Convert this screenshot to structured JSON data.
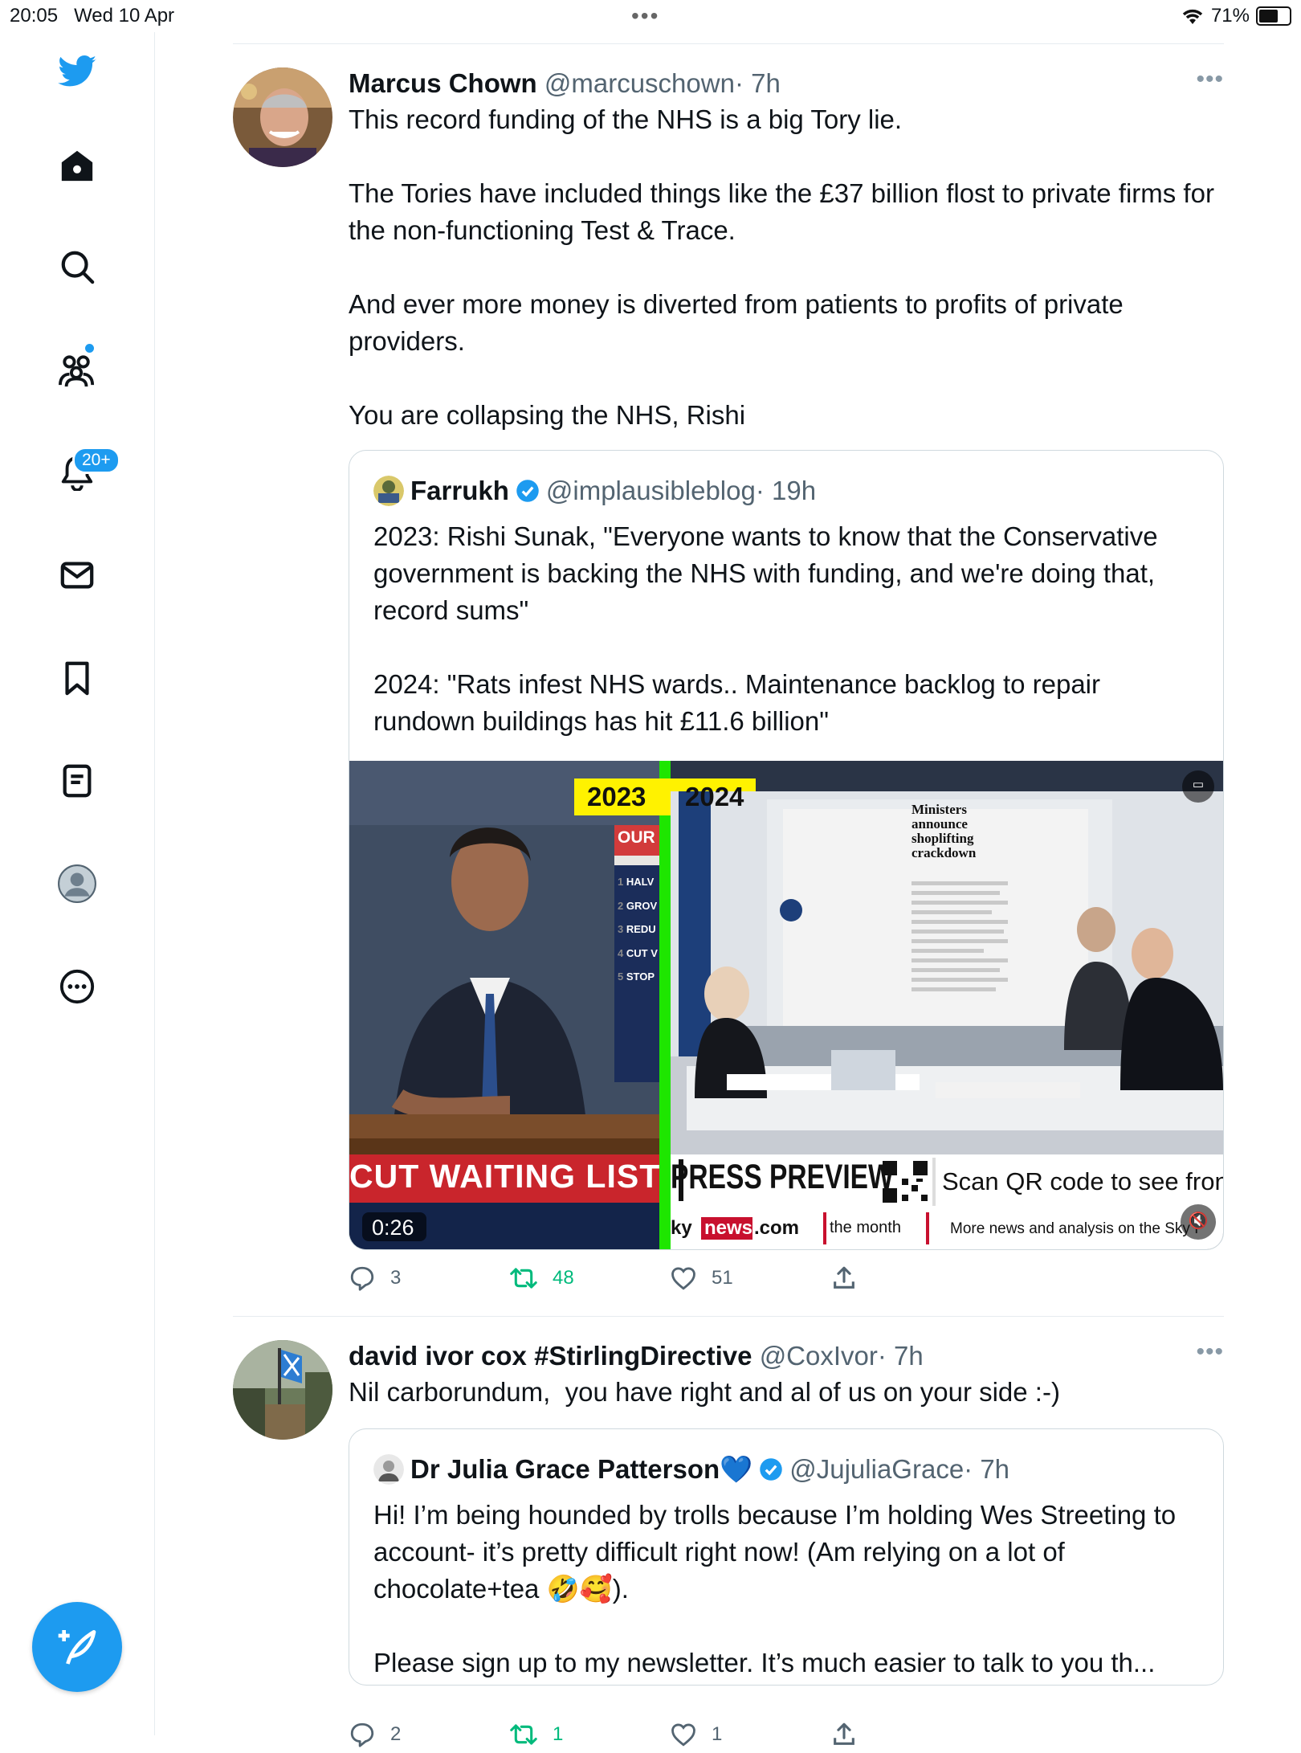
{
  "status_bar": {
    "time": "20:05",
    "date": "Wed 10 Apr",
    "battery": "71%",
    "battery_level": 0.71
  },
  "sidebar": {
    "items": [
      {
        "name": "home"
      },
      {
        "name": "explore"
      },
      {
        "name": "communities"
      },
      {
        "name": "notifications",
        "badge": "20+"
      },
      {
        "name": "messages"
      },
      {
        "name": "bookmarks"
      },
      {
        "name": "lists"
      },
      {
        "name": "profile"
      },
      {
        "name": "more"
      }
    ]
  },
  "tweets": [
    {
      "name": "Marcus Chown",
      "handle": "@marcuschown",
      "time": "· 7h",
      "text": "This record funding of the NHS is a big Tory lie.\n\nThe Tories have included things like the £37 billion flost to private firms for the non-functioning Test & Trace.\n\nAnd ever more money is diverted from patients to profits of private providers.\n\nYou are collapsing the NHS, Rishi",
      "quote": {
        "name": "Farrukh",
        "handle": "@implausibleblog",
        "time": "· 19h",
        "text": "2023: Rishi Sunak, \"Everyone wants to know that the Conservative government is backing the NHS with funding, and we're doing that, record sums\"\n\n2024: \"Rats infest NHS wards.. Maintenance backlog to repair rundown buildings has hit £11.6 billion\"",
        "video": {
          "label_2023": "2023",
          "label_2024": "2024",
          "podium_banner": "OUR",
          "podium_list": [
            "HALV",
            "GROV",
            "REDU",
            "CUT V",
            "STOP"
          ],
          "podium_numbers": [
            "1",
            "2",
            "3",
            "4",
            "5"
          ],
          "lower_third": "CUT WAITING LISTS",
          "newspaper_headline": "Ministers announce shoplifting crackdown",
          "press_preview": "PRESS PREVIEW",
          "scan_text": "Scan QR code to see front",
          "sky_logo": "ky",
          "news_box": "news",
          "dot_com": ".com",
          "ticker_1": "the month",
          "ticker_2": "More news and analysis on the Sky I",
          "duration": "0:26"
        }
      },
      "replies": "3",
      "retweets": "48",
      "likes": "51"
    },
    {
      "name": "david ivor cox #StirlingDirective",
      "handle": "@CoxIvor",
      "time": "· 7h",
      "text": "Nil carborundum,  you have right and al of us on your side :-)",
      "quote": {
        "name": "Dr Julia Grace Patterson💙",
        "handle": "@JujuliaGrace",
        "time": "· 7h",
        "text": "Hi! I’m being hounded by trolls because I’m holding Wes Streeting to account- it’s pretty difficult right now! (Am relying on a lot of chocolate+tea 🤣🥰).\n\nPlease sign up to my newsletter. It’s much easier to talk to you th..."
      },
      "replies": "2",
      "retweets": "1",
      "likes": "1"
    }
  ],
  "colors": {
    "accent": "#1d9bf0",
    "retweet": "#00ba7c",
    "muted": "#536471"
  }
}
